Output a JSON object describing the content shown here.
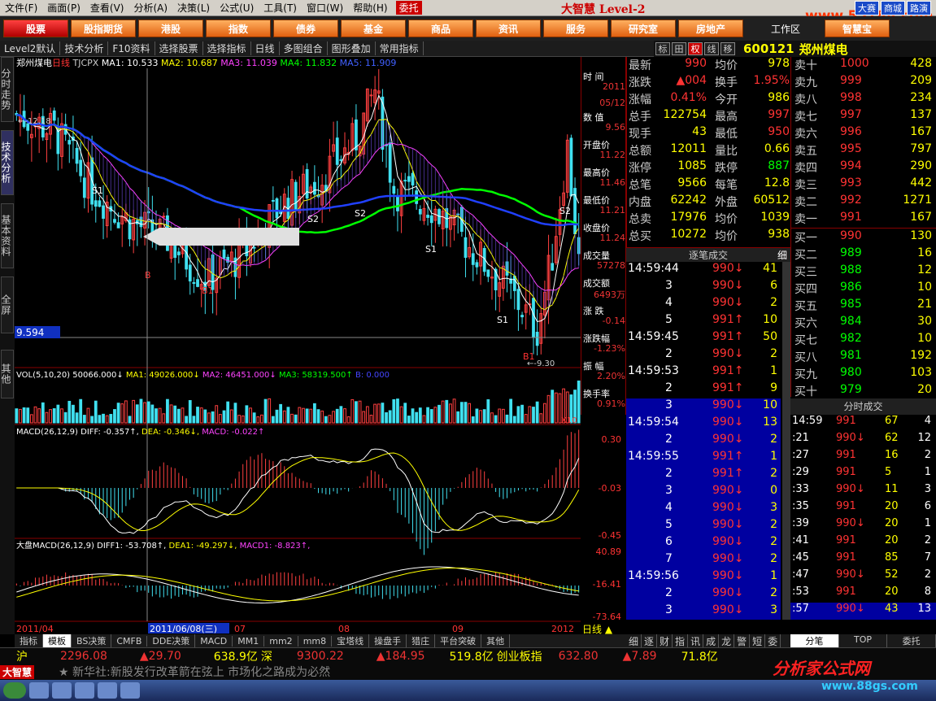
{
  "menu": {
    "items": [
      "文件(F)",
      "画面(P)",
      "查看(V)",
      "分析(A)",
      "决策(L)",
      "公式(U)",
      "工具(T)",
      "窗口(W)",
      "帮助(H)"
    ],
    "wt": "委托",
    "brand": "大智慧 Level-2",
    "right": [
      "大赛",
      "商城",
      "路演"
    ],
    "site": "www.55188.com"
  },
  "nav": {
    "items": [
      "股票",
      "股指期货",
      "港股",
      "指数",
      "债券",
      "基金",
      "商品",
      "资讯",
      "服务",
      "研究室",
      "房地产"
    ],
    "active": 0,
    "work": "工作区",
    "zhb": "智慧宝"
  },
  "toolbar": [
    "Level2默认",
    "技术分析",
    "F10资料",
    "选择股票",
    "选择指标",
    "日线",
    "多图组合",
    "图形叠加",
    "常用指标"
  ],
  "stock": {
    "code": "600121",
    "name": "郑州煤电",
    "btns": [
      "标",
      "田",
      "权",
      "线",
      "移"
    ]
  },
  "side": [
    "分时走势",
    "技术分析",
    "基本资料",
    "全屏",
    "其他"
  ],
  "kline": {
    "title": "郑州煤电",
    "period": "日线",
    "ind": "TJCPX",
    "ma": [
      {
        "n": "MA1: 10.533",
        "c": "#ffffff"
      },
      {
        "n": "MA2: 10.687",
        "c": "#ffff00"
      },
      {
        "n": "MA3: 11.039",
        "c": "#ff40ff"
      },
      {
        "n": "MA4: 11.832",
        "c": "#00ff00"
      },
      {
        "n": "MA5: 11.909",
        "c": "#4060ff"
      }
    ],
    "hi": "12.18",
    "lo": "9.30",
    "cursor": "9.594",
    "ticks": [
      "12.18",
      "9.30"
    ]
  },
  "vol": {
    "label": "VOL(5,10,20)",
    "v": "50066.000",
    "ma1": "MA1: 49026.000",
    "ma2": "MA2: 46451.000",
    "ma3": "MA3: 58319.500",
    "b": "B: 0.000",
    "unit": "X10"
  },
  "macd": {
    "label": "MACD(26,12,9)",
    "diff": "DIFF: -0.357",
    "dea": "DEA: -0.346",
    "macd": "MACD: -0.022",
    "ax": [
      "0.30",
      "-0.03",
      "-0.45"
    ]
  },
  "dpmacd": {
    "label": "大盘MACD(26,12,9)",
    "diff": "DIFF1: -53.708",
    "dea": "DEA1: -49.297",
    "macd": "MACD1: -8.823",
    "ax": [
      "40.89",
      "-16.41",
      "-73.64"
    ]
  },
  "xaxis": {
    "labels": [
      "2011/04",
      "2011/06/08(三)",
      "07",
      "08",
      "09",
      "2012"
    ],
    "period": "日线"
  },
  "info": [
    [
      "时 间",
      "2011"
    ],
    [
      "",
      "05/12"
    ],
    [
      "数 值",
      "9.56"
    ],
    [
      "开盘价",
      "11.22"
    ],
    [
      "最高价",
      "11.46"
    ],
    [
      "最低价",
      "11.21"
    ],
    [
      "收盘价",
      "11.24"
    ],
    [
      "成交量",
      "57278"
    ],
    [
      "成交额",
      "6493万"
    ],
    [
      "涨 跌",
      "-0.14"
    ],
    [
      "涨跌幅",
      "-1.23%"
    ],
    [
      "振 幅",
      "2.20%"
    ],
    [
      "换手率",
      "0.91%"
    ]
  ],
  "quote": [
    [
      "最新",
      "990",
      "均价",
      "978"
    ],
    [
      "涨跌",
      "▲004",
      "换手",
      "1.95%"
    ],
    [
      "涨幅",
      "0.41%",
      "今开",
      "986"
    ],
    [
      "总手",
      "122754",
      "最高",
      "997"
    ],
    [
      "现手",
      "43",
      "最低",
      "950"
    ],
    [
      "总额",
      "12011",
      "量比",
      "0.66"
    ],
    [
      "涨停",
      "1085",
      "跌停",
      "887"
    ],
    [
      "总笔",
      "9566",
      "每笔",
      "12.8"
    ],
    [
      "内盘",
      "62242",
      "外盘",
      "60512"
    ],
    [
      "总卖",
      "17976",
      "均价",
      "1039"
    ],
    [
      "总买",
      "10272",
      "均价",
      "938"
    ]
  ],
  "book": [
    [
      "卖十",
      "1000",
      "428"
    ],
    [
      "卖九",
      "999",
      "209"
    ],
    [
      "卖八",
      "998",
      "234"
    ],
    [
      "卖七",
      "997",
      "137"
    ],
    [
      "卖六",
      "996",
      "167"
    ],
    [
      "卖五",
      "995",
      "797"
    ],
    [
      "卖四",
      "994",
      "290"
    ],
    [
      "卖三",
      "993",
      "442"
    ],
    [
      "卖二",
      "992",
      "1271"
    ],
    [
      "卖一",
      "991",
      "167"
    ],
    [
      "买一",
      "990",
      "130"
    ],
    [
      "买二",
      "989",
      "16"
    ],
    [
      "买三",
      "988",
      "12"
    ],
    [
      "买四",
      "986",
      "10"
    ],
    [
      "买五",
      "985",
      "21"
    ],
    [
      "买六",
      "984",
      "30"
    ],
    [
      "买七",
      "982",
      "10"
    ],
    [
      "买八",
      "981",
      "192"
    ],
    [
      "买九",
      "980",
      "103"
    ],
    [
      "买十",
      "979",
      "20"
    ]
  ],
  "tickhdr": "逐笔成交",
  "tickbtn": "细",
  "ticks": [
    [
      "14:59:44",
      "990",
      "41"
    ],
    [
      "3",
      "990",
      "6"
    ],
    [
      "4",
      "990",
      "2"
    ],
    [
      "5",
      "991",
      "10"
    ],
    [
      "14:59:45",
      "991",
      "50"
    ],
    [
      "2",
      "990",
      "2"
    ],
    [
      "14:59:53",
      "991",
      "1"
    ],
    [
      "2",
      "991",
      "9"
    ],
    [
      "3",
      "990",
      "10"
    ],
    [
      "14:59:54",
      "990",
      "13"
    ],
    [
      "2",
      "990",
      "2"
    ],
    [
      "14:59:55",
      "991",
      "1"
    ],
    [
      "2",
      "991",
      "2"
    ],
    [
      "3",
      "990",
      "0"
    ],
    [
      "4",
      "990",
      "3"
    ],
    [
      "5",
      "990",
      "2"
    ],
    [
      "6",
      "990",
      "2"
    ],
    [
      "7",
      "990",
      "2"
    ],
    [
      "14:59:56",
      "990",
      "1"
    ],
    [
      "2",
      "990",
      "2"
    ],
    [
      "3",
      "990",
      "3"
    ]
  ],
  "fshdr": "分时成交",
  "fs": [
    [
      "14:59",
      "991",
      "67",
      "4"
    ],
    [
      ":21",
      "990",
      "62",
      "12"
    ],
    [
      ":27",
      "991",
      "16",
      "2"
    ],
    [
      ":29",
      "991",
      "5",
      "1"
    ],
    [
      ":33",
      "990",
      "11",
      "3"
    ],
    [
      ":35",
      "991",
      "20",
      "6"
    ],
    [
      ":39",
      "990",
      "20",
      "1"
    ],
    [
      ":41",
      "991",
      "20",
      "2"
    ],
    [
      ":45",
      "991",
      "85",
      "7"
    ],
    [
      ":47",
      "990",
      "52",
      "2"
    ],
    [
      ":53",
      "991",
      "20",
      "8"
    ],
    [
      ":57",
      "990",
      "43",
      "13"
    ]
  ],
  "bottabs": [
    "指标",
    "模板",
    "BS决策",
    "CMFB",
    "DDE决策",
    "MACD",
    "MM1",
    "mm2",
    "mm8",
    "宝塔线",
    "操盘手",
    "猎庄",
    "平台突破",
    "其他"
  ],
  "midtabs": [
    "细",
    "逐",
    "财",
    "指",
    "讯",
    "成",
    "龙",
    "警",
    "短",
    "委"
  ],
  "rtabs": [
    "分笔",
    "TOP",
    "委托"
  ],
  "status": {
    "sh": "沪",
    "shv": "2296.08",
    "shc": "▲29.70",
    "sha": "638.9亿",
    "sz": "深",
    "szv": "9300.22",
    "szc": "▲184.95",
    "sza": "519.8亿",
    "cy": "创业板指",
    "cyv": "632.80",
    "cyc": "▲7.89",
    "cya": "71.8亿"
  },
  "news": "★ 新华社:新股发行改革箭在弦上 市场化之路成为必然",
  "watermark": "分析家公式网",
  "watermark2": "www.88gs.com"
}
